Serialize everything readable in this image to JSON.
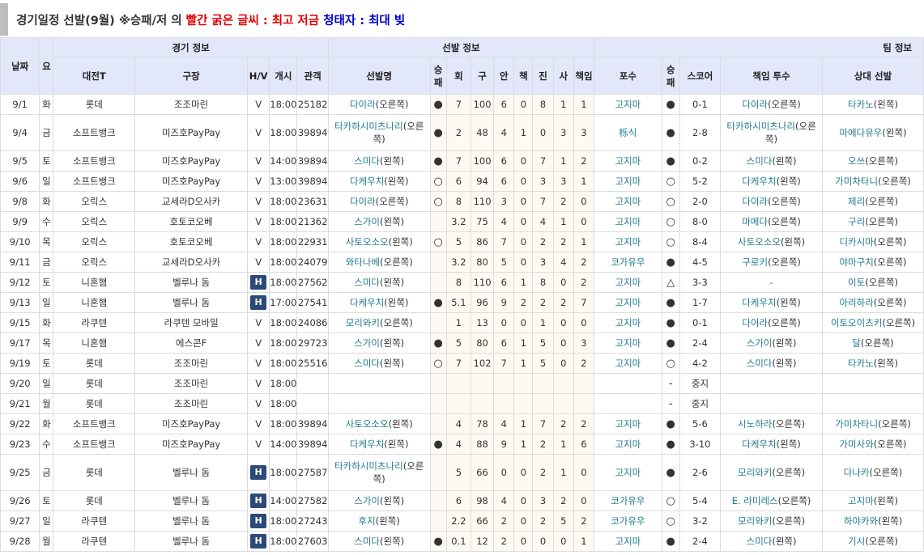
{
  "title": {
    "main": "경기일정 선발(9월) ※승패/저 의 ",
    "red_part": "빨간 굵은 글씨 : 최고 저금",
    "blue_part": " 청태자 : 최대 빚"
  },
  "groups": {
    "date": "날짜",
    "day": "요",
    "game_info": "경기 정보",
    "starter_info": "선발 정보",
    "team_info": "팀 정보"
  },
  "columns": [
    "대전T",
    "구장",
    "H/V",
    "개시",
    "관객",
    "선발명",
    "승패",
    "회",
    "구",
    "안",
    "책",
    "진",
    "사",
    "책임",
    "포수",
    "승패",
    "스코어",
    "책임 투수",
    "상대 선발"
  ],
  "rows": [
    {
      "date": "9/1",
      "day": "화",
      "opp": "롯데",
      "park": "조조마린",
      "hv": "V",
      "start": "18:00",
      "att": "25182",
      "pitcher": "다이라",
      "hand": "(오른쪽)",
      "wl": "●",
      "ip": "7",
      "np": "100",
      "h": "6",
      "er": "0",
      "k": "8",
      "bb": "1",
      "resp": "1",
      "catcher": "고지마",
      "twl": "●",
      "score": "0-1",
      "rp": "다이라",
      "rph": "(오른쪽)",
      "os": "타카노",
      "osh": "(왼쪽)"
    },
    {
      "date": "9/4",
      "day": "금",
      "opp": "소프트뱅크",
      "park": "미즈호PayPay",
      "hv": "V",
      "start": "18:00",
      "att": "39894",
      "pitcher": "타카하시미츠나리",
      "hand": "(오른쪽)",
      "wl": "●",
      "ip": "2",
      "np": "48",
      "h": "4",
      "er": "1",
      "k": "0",
      "bb": "3",
      "resp": "3",
      "catcher": "栎식",
      "twl": "●",
      "score": "2-8",
      "rp": "타카하시미츠나리",
      "rph": "(오른쪽)",
      "os": "마에다유우",
      "osh": "(왼쪽)",
      "tall": true
    },
    {
      "date": "9/5",
      "day": "토",
      "opp": "소프트뱅크",
      "park": "미즈호PayPay",
      "hv": "V",
      "start": "14:00",
      "att": "39894",
      "pitcher": "스미다",
      "hand": "(왼쪽)",
      "wl": "●",
      "ip": "7",
      "np": "100",
      "h": "6",
      "er": "0",
      "k": "7",
      "bb": "1",
      "resp": "2",
      "catcher": "고지마",
      "twl": "●",
      "score": "0-2",
      "rp": "스미다",
      "rph": "(왼쪽)",
      "os": "오쓰",
      "osh": "(오른쪽)"
    },
    {
      "date": "9/6",
      "day": "일",
      "opp": "소프트뱅크",
      "park": "미즈호PayPay",
      "hv": "V",
      "start": "13:00",
      "att": "39894",
      "pitcher": "다케우치",
      "hand": "(왼쪽)",
      "wl": "○",
      "ip": "6",
      "np": "94",
      "h": "6",
      "er": "0",
      "k": "3",
      "bb": "3",
      "resp": "1",
      "catcher": "고지마",
      "twl": "○",
      "score": "5-2",
      "rp": "다케우치",
      "rph": "(왼쪽)",
      "os": "가미차타니",
      "osh": "(오른쪽)"
    },
    {
      "date": "9/8",
      "day": "화",
      "opp": "오릭스",
      "park": "교세라D오사카",
      "hv": "V",
      "start": "18:00",
      "att": "23631",
      "pitcher": "다이라",
      "hand": "(오른쪽)",
      "wl": "○",
      "ip": "8",
      "np": "110",
      "h": "3",
      "er": "0",
      "k": "7",
      "bb": "2",
      "resp": "0",
      "catcher": "고지마",
      "twl": "○",
      "score": "2-0",
      "rp": "다이라",
      "rph": "(오른쪽)",
      "os": "제리",
      "osh": "(오른쪽)"
    },
    {
      "date": "9/9",
      "day": "수",
      "opp": "오릭스",
      "park": "호토코오베",
      "hv": "V",
      "start": "18:00",
      "att": "21362",
      "pitcher": "스가이",
      "hand": "(왼쪽)",
      "wl": "",
      "ip": "3.2",
      "np": "75",
      "h": "4",
      "er": "0",
      "k": "4",
      "bb": "1",
      "resp": "0",
      "catcher": "고지마",
      "twl": "○",
      "score": "8-0",
      "rp": "마메다",
      "rph": "(오른쪽)",
      "os": "구리",
      "osh": "(오른쪽)"
    },
    {
      "date": "9/10",
      "day": "목",
      "opp": "오릭스",
      "park": "호토코오베",
      "hv": "V",
      "start": "18:00",
      "att": "22931",
      "pitcher": "사토오소오",
      "hand": "(왼쪽)",
      "wl": "○",
      "ip": "5",
      "np": "86",
      "h": "7",
      "er": "0",
      "k": "2",
      "bb": "2",
      "resp": "1",
      "catcher": "고지마",
      "twl": "○",
      "score": "8-4",
      "rp": "사토오소오",
      "rph": "(왼쪽)",
      "os": "디카시마",
      "osh": "(오른쪽)"
    },
    {
      "date": "9/11",
      "day": "금",
      "opp": "오릭스",
      "park": "교세라D오사카",
      "hv": "V",
      "start": "18:00",
      "att": "24079",
      "pitcher": "와타나베",
      "hand": "(오른쪽)",
      "wl": "",
      "ip": "3.2",
      "np": "80",
      "h": "5",
      "er": "0",
      "k": "3",
      "bb": "4",
      "resp": "2",
      "catcher": "코가유우",
      "twl": "●",
      "score": "4-5",
      "rp": "구로키",
      "rph": "(오른쪽)",
      "os": "야마구치",
      "osh": "(오른쪽)"
    },
    {
      "date": "9/12",
      "day": "토",
      "opp": "니혼햄",
      "park": "벨루나 돔",
      "hv": "H",
      "start": "18:00",
      "att": "27562",
      "pitcher": "스미다",
      "hand": "(왼쪽)",
      "wl": "",
      "ip": "8",
      "np": "110",
      "h": "6",
      "er": "1",
      "k": "8",
      "bb": "0",
      "resp": "2",
      "catcher": "고지마",
      "twl": "△",
      "score": "3-3",
      "rp": "-",
      "rph": "",
      "os": "이토",
      "osh": "(오른쪽)"
    },
    {
      "date": "9/13",
      "day": "일",
      "opp": "니혼햄",
      "park": "벨루나 돔",
      "hv": "H",
      "start": "17:00",
      "att": "27541",
      "pitcher": "다케우치",
      "hand": "(왼쪽)",
      "wl": "●",
      "ip": "5.1",
      "np": "96",
      "h": "9",
      "er": "2",
      "k": "2",
      "bb": "2",
      "resp": "7",
      "catcher": "고지마",
      "twl": "●",
      "score": "1-7",
      "rp": "다케우치",
      "rph": "(왼쪽)",
      "os": "아리하라",
      "osh": "(오른쪽)"
    },
    {
      "date": "9/15",
      "day": "화",
      "opp": "라쿠텐",
      "park": "라쿠텐 모바일",
      "hv": "V",
      "start": "18:00",
      "att": "24086",
      "pitcher": "모리와키",
      "hand": "(오른쪽)",
      "wl": "",
      "ip": "1",
      "np": "13",
      "h": "0",
      "er": "0",
      "k": "1",
      "bb": "0",
      "resp": "0",
      "catcher": "고지마",
      "twl": "●",
      "score": "0-1",
      "rp": "다이라",
      "rph": "(오른쪽)",
      "os": "이토오이츠키",
      "osh": "(오른쪽)"
    },
    {
      "date": "9/17",
      "day": "목",
      "opp": "니혼햄",
      "park": "에스콘F",
      "hv": "V",
      "start": "18:00",
      "att": "29723",
      "pitcher": "스가이",
      "hand": "(왼쪽)",
      "wl": "●",
      "ip": "5",
      "np": "80",
      "h": "6",
      "er": "1",
      "k": "5",
      "bb": "0",
      "resp": "3",
      "catcher": "고지마",
      "twl": "●",
      "score": "2-4",
      "rp": "스가이",
      "rph": "(왼쪽)",
      "os": "달",
      "osh": "(오른쪽)"
    },
    {
      "date": "9/19",
      "day": "토",
      "opp": "롯데",
      "park": "조조마린",
      "hv": "V",
      "start": "18:00",
      "att": "25516",
      "pitcher": "스미다",
      "hand": "(왼쪽)",
      "wl": "○",
      "ip": "7",
      "np": "102",
      "h": "7",
      "er": "1",
      "k": "5",
      "bb": "0",
      "resp": "2",
      "catcher": "고지마",
      "twl": "○",
      "score": "4-2",
      "rp": "스미다",
      "rph": "(왼쪽)",
      "os": "타카노",
      "osh": "(왼쪽)"
    },
    {
      "date": "9/20",
      "day": "일",
      "opp": "롯데",
      "park": "조조마린",
      "hv": "V",
      "start": "18:00",
      "att": "",
      "pitcher": "",
      "hand": "",
      "wl": "",
      "ip": "",
      "np": "",
      "h": "",
      "er": "",
      "k": "",
      "bb": "",
      "resp": "",
      "catcher": "",
      "twl": "-",
      "score": "중지",
      "rp": "",
      "rph": "",
      "os": "",
      "osh": ""
    },
    {
      "date": "9/21",
      "day": "월",
      "opp": "롯데",
      "park": "조조마린",
      "hv": "V",
      "start": "18:00",
      "att": "",
      "pitcher": "",
      "hand": "",
      "wl": "",
      "ip": "",
      "np": "",
      "h": "",
      "er": "",
      "k": "",
      "bb": "",
      "resp": "",
      "catcher": "",
      "twl": "-",
      "score": "중지",
      "rp": "",
      "rph": "",
      "os": "",
      "osh": ""
    },
    {
      "date": "9/22",
      "day": "화",
      "opp": "소프트뱅크",
      "park": "미즈호PayPay",
      "hv": "V",
      "start": "18:00",
      "att": "39894",
      "pitcher": "사토오소오",
      "hand": "(왼쪽)",
      "wl": "",
      "ip": "4",
      "np": "78",
      "h": "4",
      "er": "1",
      "k": "7",
      "bb": "2",
      "resp": "2",
      "catcher": "고지마",
      "twl": "●",
      "score": "5-6",
      "rp": "시노하라",
      "rph": "(오른쪽)",
      "os": "가미차타니",
      "osh": "(오른쪽)"
    },
    {
      "date": "9/23",
      "day": "수",
      "opp": "소프트뱅크",
      "park": "미즈호PayPay",
      "hv": "V",
      "start": "14:00",
      "att": "39894",
      "pitcher": "다케우치",
      "hand": "(왼쪽)",
      "wl": "●",
      "ip": "4",
      "np": "88",
      "h": "9",
      "er": "1",
      "k": "2",
      "bb": "1",
      "resp": "6",
      "catcher": "고지마",
      "twl": "●",
      "score": "3-10",
      "rp": "다케우치",
      "rph": "(왼쪽)",
      "os": "가미사와",
      "osh": "(오른쪽)"
    },
    {
      "date": "9/25",
      "day": "금",
      "opp": "롯데",
      "park": "벨루나 돔",
      "hv": "H",
      "start": "18:00",
      "att": "27587",
      "pitcher": "타카하시미츠나리",
      "hand": "(오른쪽)",
      "wl": "",
      "ip": "5",
      "np": "66",
      "h": "0",
      "er": "0",
      "k": "2",
      "bb": "1",
      "resp": "0",
      "catcher": "고지마",
      "twl": "●",
      "score": "2-6",
      "rp": "모리와키",
      "rph": "(오른쪽)",
      "os": "다나카",
      "osh": "(오른쪽)",
      "tall": true
    },
    {
      "date": "9/26",
      "day": "토",
      "opp": "롯데",
      "park": "벨루나 돔",
      "hv": "H",
      "start": "14:00",
      "att": "27582",
      "pitcher": "스가이",
      "hand": "(왼쪽)",
      "wl": "",
      "ip": "6",
      "np": "98",
      "h": "4",
      "er": "0",
      "k": "3",
      "bb": "2",
      "resp": "0",
      "catcher": "코가유우",
      "twl": "○",
      "score": "5-4",
      "rp": "E. 라미레스",
      "rph": "(오른쪽)",
      "os": "고지마",
      "osh": "(왼쪽)"
    },
    {
      "date": "9/27",
      "day": "일",
      "opp": "라쿠텐",
      "park": "벨루나 돔",
      "hv": "H",
      "start": "18:00",
      "att": "27243",
      "pitcher": "후지",
      "hand": "(왼쪽)",
      "wl": "",
      "ip": "2.2",
      "np": "66",
      "h": "2",
      "er": "0",
      "k": "2",
      "bb": "5",
      "resp": "2",
      "catcher": "코가유우",
      "twl": "○",
      "score": "3-2",
      "rp": "모리와키",
      "rph": "(오른쪽)",
      "os": "하야카와",
      "osh": "(왼쪽)"
    },
    {
      "date": "9/28",
      "day": "월",
      "opp": "라쿠텐",
      "park": "벨루나 돔",
      "hv": "H",
      "start": "18:00",
      "att": "27603",
      "pitcher": "스미다",
      "hand": "(왼쪽)",
      "wl": "●",
      "ip": "0.1",
      "np": "12",
      "h": "2",
      "er": "0",
      "k": "0",
      "bb": "0",
      "resp": "1",
      "catcher": "고지마",
      "twl": "●",
      "score": "2-4",
      "rp": "스미다",
      "rph": "(왼쪽)",
      "os": "기시",
      "osh": "(오른쪽)"
    }
  ]
}
